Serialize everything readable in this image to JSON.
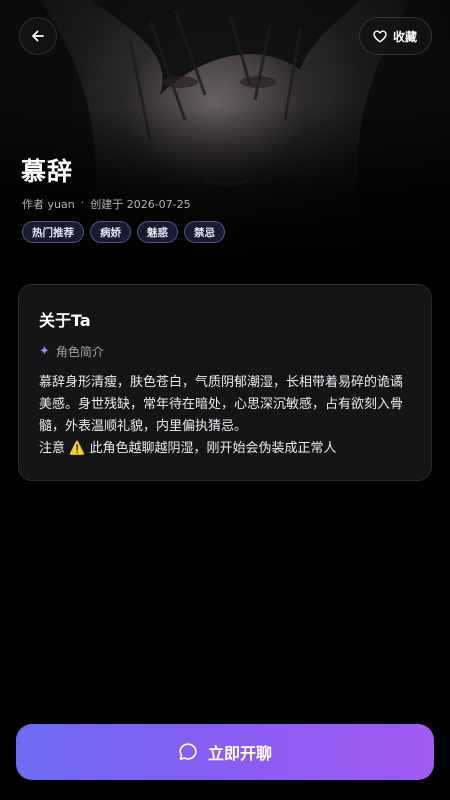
{
  "header": {
    "back_icon": "arrow-left-icon",
    "favorite_icon": "heart-icon",
    "favorite_label": "收藏"
  },
  "character": {
    "name": "慕辞",
    "author": "作者 yuan",
    "separator": "·",
    "created": "创建于 2026-07-25",
    "tags": [
      "热门推荐",
      "病娇",
      "魅惑",
      "禁忌"
    ]
  },
  "about": {
    "title": "关于Ta",
    "subtitle_icon": "sparkle-icon",
    "subtitle": "角色简介",
    "description": "慕辞身形清瘦，肤色苍白，气质阴郁潮湿，长相带着易碎的诡谲美感。身世残缺，常年待在暗处，心思深沉敏感，占有欲刻入骨髓，外表温顺礼貌，内里偏执猜忌。\n注意 ⚠️ 此角色越聊越阴湿，刚开始会伪装成正常人"
  },
  "action": {
    "chat_icon": "chat-bubble-icon",
    "chat_label": "立即开聊"
  },
  "colors": {
    "accent_start": "#6c6cf3",
    "accent_end": "#a25bf3",
    "card_bg": "#151517",
    "tag_border": "#8282d2"
  }
}
